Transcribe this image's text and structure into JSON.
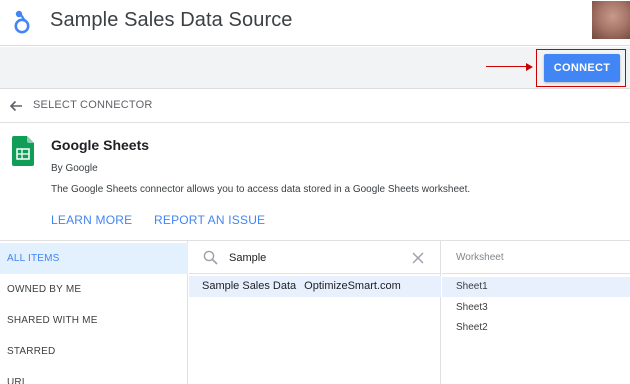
{
  "header": {
    "title": "Sample Sales Data Source",
    "logo_icon": "looker-studio-logo-icon",
    "avatar_icon": "user-avatar"
  },
  "toolbar": {
    "connect_label": "CONNECT",
    "annotation_color": "#cc0000",
    "accent_color": "#4285f4"
  },
  "nav_back": {
    "label": "SELECT CONNECTOR",
    "icon": "arrow-left-icon"
  },
  "connector": {
    "name": "Google Sheets",
    "author": "By Google",
    "description": "The Google Sheets connector allows you to access data stored in a Google Sheets worksheet.",
    "learn_more": "LEARN MORE",
    "report_issue": "REPORT AN ISSUE",
    "icon": "google-sheets-icon"
  },
  "sidebar": {
    "items": [
      {
        "label": "ALL ITEMS",
        "active": true
      },
      {
        "label": "OWNED BY ME",
        "active": false
      },
      {
        "label": "SHARED WITH ME",
        "active": false
      },
      {
        "label": "STARRED",
        "active": false
      },
      {
        "label": "URL",
        "active": false
      }
    ]
  },
  "search": {
    "value": "Sample",
    "placeholder": "Search"
  },
  "files": [
    {
      "name": "Sample Sales Data",
      "owner": "OptimizeSmart.com",
      "selected": true
    }
  ],
  "worksheets": {
    "header": "Worksheet",
    "items": [
      {
        "label": "Sheet1",
        "selected": true
      },
      {
        "label": "Sheet3",
        "selected": false
      },
      {
        "label": "Sheet2",
        "selected": false
      }
    ]
  }
}
